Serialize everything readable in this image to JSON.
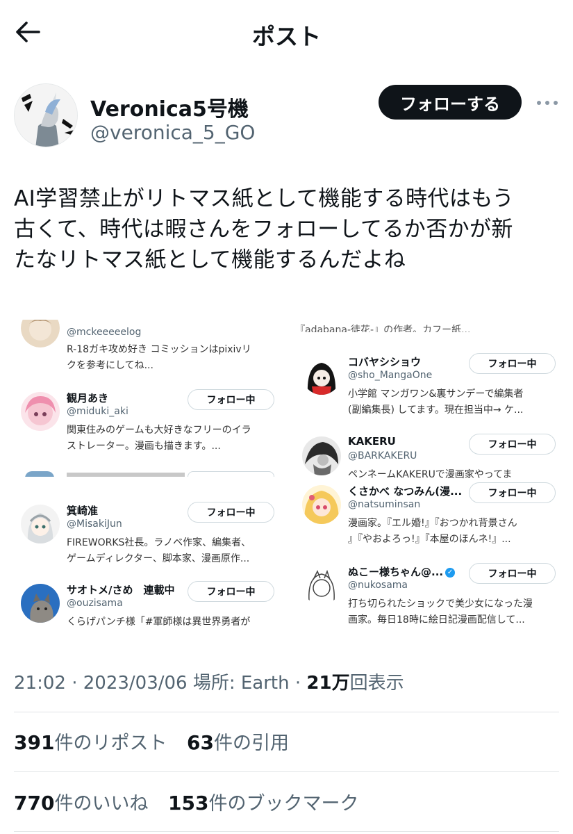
{
  "header": {
    "title": "ポスト",
    "back_icon": "arrow-left-icon"
  },
  "author": {
    "display_name": "Veronica5号機",
    "handle": "@veronica_5_GO",
    "follow_label": "フォローする",
    "more_icon": "ellipsis-icon"
  },
  "tweet": {
    "lines": [
      "AI学習禁止がリトマス紙として機能する時代はもう",
      "古くて、時代は暇さんをフォローしてるか否かが新",
      "たなリトマス紙として機能するんだよね"
    ]
  },
  "media": {
    "left": {
      "accounts": [
        {
          "name": "",
          "handle": "@mckeeeeelog",
          "bio": [
            "R-18ガキ攻め好き コミッションはpixivリ",
            "クを参考にしてね..."
          ]
        },
        {
          "name": "観月あき",
          "handle": "@miduki_aki",
          "follow": "フォロー中",
          "bio": [
            "関東住みのゲームも大好きなフリーのイラ",
            "ストレーター。漫画も描きます。..."
          ]
        },
        {
          "name": "箕崎准",
          "handle": "@MisakiJun",
          "follow": "フォロー中",
          "bio": [
            "FIREWORKS社長。ラノベ作家、編集者、",
            "ゲームディレクター、脚本家、漫画原作..."
          ]
        },
        {
          "name": "サオトメ/さめ　連載中",
          "handle": "@ouzisama",
          "follow": "フォロー中",
          "bio": [
            "くらげパンチ様「#軍師様は異世界勇者が"
          ]
        }
      ]
    },
    "right": {
      "top_strip": "『adabana-徒花-』の作者。カフー紙...",
      "accounts": [
        {
          "name": "コバヤシショウ",
          "handle": "@sho_MangaOne",
          "follow": "フォロー中",
          "bio": [
            "小学館 マンガワン&裏サンデーで編集者",
            "(副編集長) してます。現在担当中→ ケ..."
          ]
        },
        {
          "name": "KAKERU",
          "handle": "@BARKAKERU",
          "follow": "フォロー中",
          "bio": [
            "ペンネームKAKERUで漫画家やってま"
          ]
        },
        {
          "name": "くさかべ なつみん(漫...",
          "handle": "@natsuminsan",
          "follow": "フォロー中",
          "bio": [
            "漫画家。『エル婚!』『おつかれ背景さん",
            "』『やおよろっ!』『本屋のほんネ!』..."
          ]
        },
        {
          "name": "ぬこー様ちゃん@...",
          "handle": "@nukosama",
          "follow": "フォロー中",
          "verified": true,
          "bio": [
            "打ち切られたショックで美少女になった漫",
            "画家。毎日18時に絵日記漫画配信して..."
          ]
        }
      ]
    }
  },
  "meta": {
    "time": "21:02",
    "date": "2023/03/06",
    "location": "場所: Earth",
    "views_count": "21万",
    "views_label": "回表示"
  },
  "stats": {
    "reposts_count": "391",
    "reposts_label": "件のリポスト",
    "quotes_count": "63",
    "quotes_label": "件の引用",
    "likes_count": "770",
    "likes_label": "件のいいね",
    "bookmarks_count": "153",
    "bookmarks_label": "件のブックマーク"
  }
}
